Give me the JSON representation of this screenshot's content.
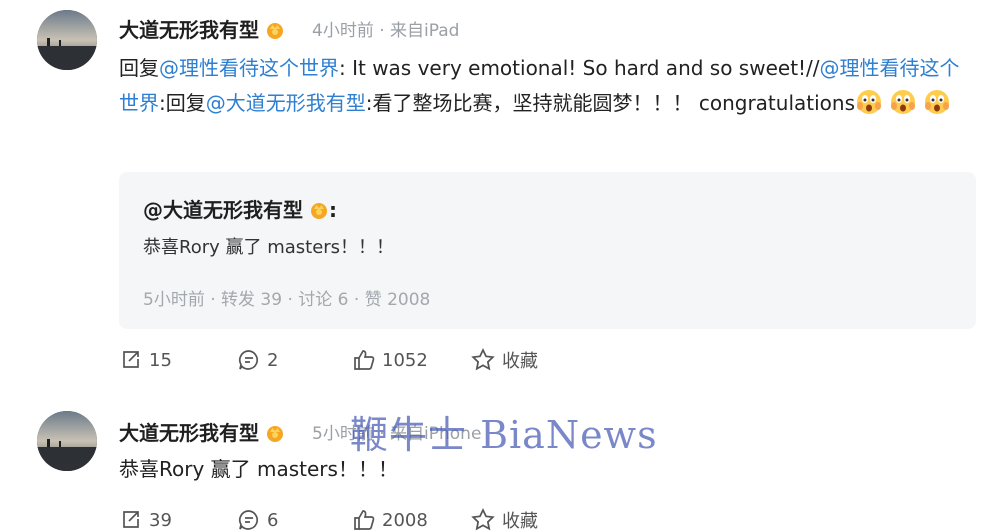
{
  "posts": [
    {
      "author": "大道无形我有型",
      "meta": "4小时前 · 来自iPad",
      "text": {
        "p1": "回复",
        "m1": "@理性看待这个世界",
        "p2": ": It was very emotional! So hard and so sweet!//",
        "m2": "@理性看待这个世界",
        "p3": ":回复",
        "m3": "@大道无形我有型",
        "p4": ":看了整场比赛，坚持就能圆梦！！！ congratulations"
      },
      "quote": {
        "author": "@大道无形我有型",
        "colon": ":",
        "text": "恭喜Rory 赢了 masters！！！",
        "meta": "5小时前  · 转发 39 · 讨论 6 · 赞 2008"
      },
      "actions": {
        "repost": "15",
        "comment": "2",
        "like": "1052",
        "fav": "收藏"
      }
    },
    {
      "author": "大道无形我有型",
      "meta": "5小时前 · 来自iPhone",
      "text": "恭喜Rory 赢了 masters！！！",
      "actions": {
        "repost": "39",
        "comment": "6",
        "like": "2008",
        "fav": "收藏"
      }
    }
  ],
  "watermark": "鞭牛士 BiaNews",
  "colors": {
    "mention": "#2e7fd1",
    "meta": "#9aa0a6",
    "card": "#f5f6f7"
  },
  "icons": [
    "vip-badge-icon",
    "shocked-emoji-icon",
    "repost-icon",
    "comment-icon",
    "like-icon",
    "favorite-star-icon"
  ]
}
